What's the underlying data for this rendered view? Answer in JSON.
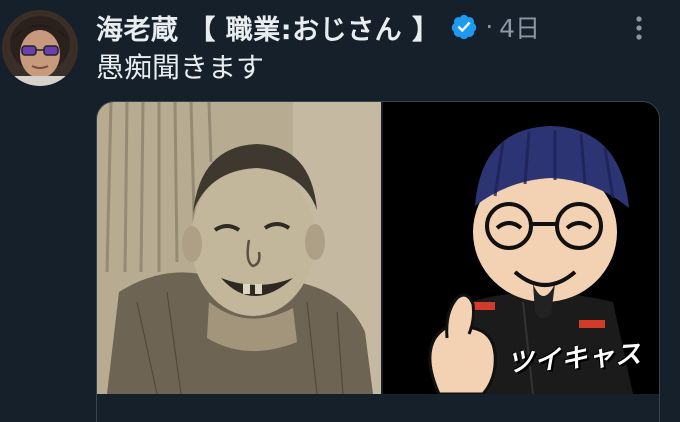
{
  "tweet": {
    "display_name": "海老蔵 【 職業:おじさん 】",
    "separator": "·",
    "timestamp": "4日",
    "text": "愚痴聞きます"
  },
  "media": {
    "right_image_stamp": "ツイキャス"
  },
  "icons": {
    "verified": "verified-badge-icon",
    "more": "more-vertical-icon"
  },
  "colors": {
    "background": "#15202b",
    "primary_text": "#e8edf0",
    "secondary_text": "#8b98a5",
    "verified_blue": "#1d9bf0",
    "border": "#38444d"
  }
}
